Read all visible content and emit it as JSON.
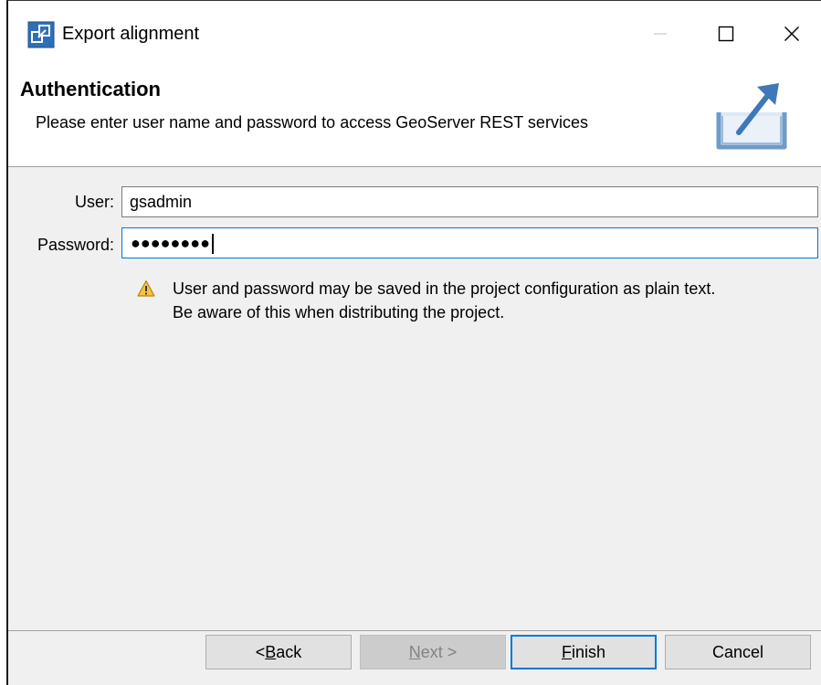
{
  "window": {
    "title": "Export alignment"
  },
  "banner": {
    "title": "Authentication",
    "description": "Please enter user name and password to access GeoServer REST services"
  },
  "form": {
    "user_label": "User:",
    "user_value": "gsadmin",
    "password_label": "Password:",
    "password_masked": "●●●●●●●●",
    "warning_line1": "User and password may be saved in the project configuration as plain text.",
    "warning_line2": "Be aware of this when distributing the project."
  },
  "buttons": {
    "back_prefix": "< ",
    "back_mnemonic": "B",
    "back_rest": "ack",
    "next_mnemonic": "N",
    "next_rest": "ext >",
    "finish_mnemonic": "F",
    "finish_rest": "inish",
    "cancel": "Cancel"
  },
  "icons": {
    "app": "export-alignment-icon",
    "banner": "export-arrow-icon",
    "warning": "warning-icon",
    "minimize": "minimize-icon",
    "maximize": "maximize-icon",
    "close": "close-icon"
  },
  "colors": {
    "accent": "#0078d7",
    "warning": "#f5c342"
  }
}
